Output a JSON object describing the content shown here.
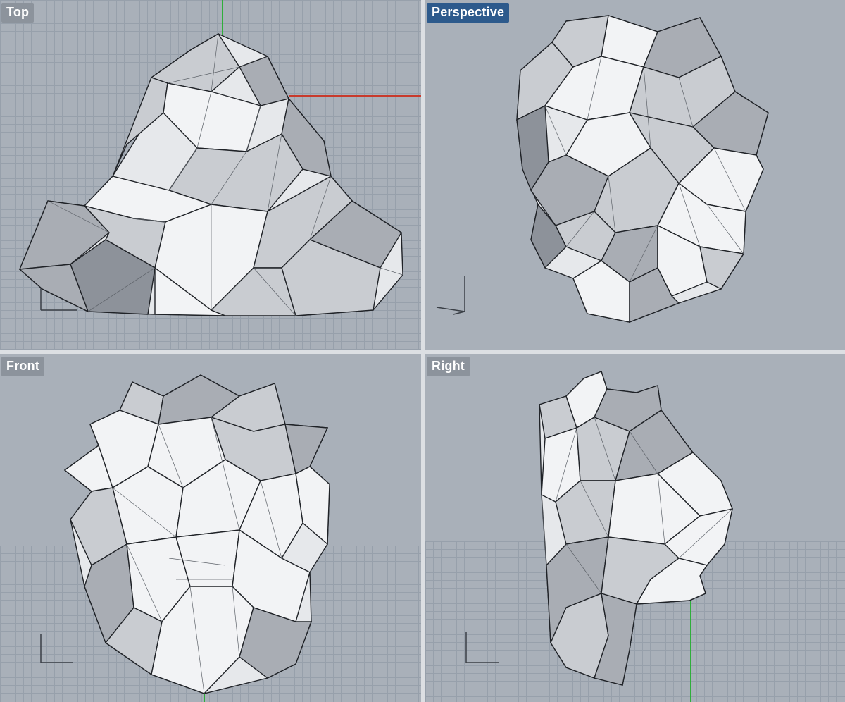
{
  "viewports": {
    "top": {
      "label": "Top"
    },
    "perspective": {
      "label": "Perspective",
      "active": true
    },
    "front": {
      "label": "Front"
    },
    "right": {
      "label": "Right"
    }
  },
  "colors": {
    "viewport_bg": "#a9b0b9",
    "grid_line": "#97a0ab",
    "active_label_bg": "#2d5a8c",
    "label_bg": "#8c939c",
    "x_axis": "#c83a2c",
    "y_axis": "#2fae3b"
  },
  "icons": [
    "axis-indicator-icon"
  ]
}
